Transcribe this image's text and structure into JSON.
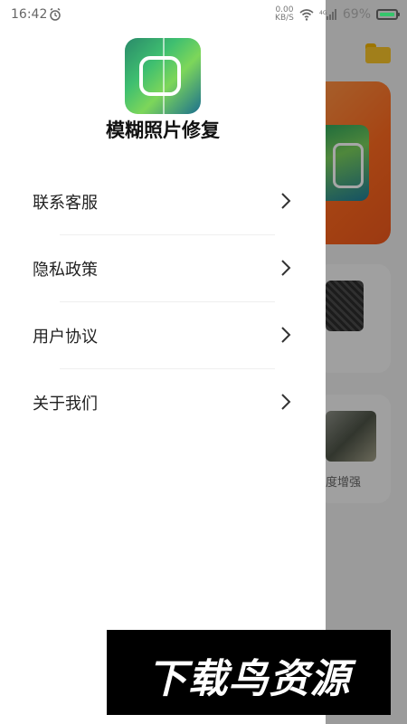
{
  "status_bar": {
    "time": "16:42",
    "net_speed_value": "0.00",
    "net_speed_unit": "KB/S",
    "signal_label": "4G",
    "battery_percent": "69%",
    "icons": [
      "alarm-icon",
      "wifi-icon",
      "signal-icon",
      "battery-icon"
    ]
  },
  "drawer": {
    "app_title": "模糊照片修复",
    "menu": [
      {
        "label": "联系客服"
      },
      {
        "label": "隐私政策"
      },
      {
        "label": "用户协议"
      },
      {
        "label": "关于我们"
      }
    ]
  },
  "background": {
    "card_label": "度增强"
  },
  "watermark": {
    "text": "下载鸟资源"
  },
  "colors": {
    "hero_orange": "#ff6a1f",
    "folder_yellow": "#f7c32a",
    "battery_green": "#35c56b"
  }
}
